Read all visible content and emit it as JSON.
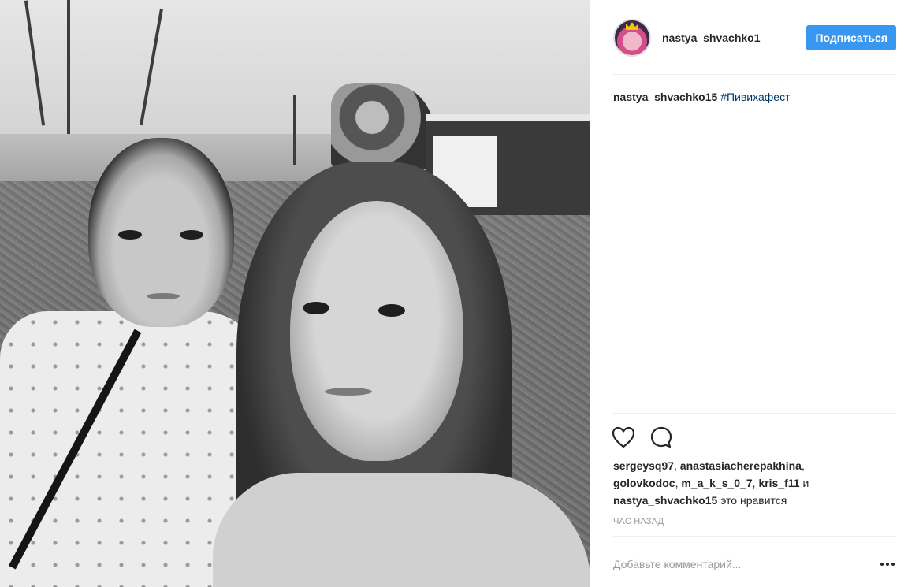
{
  "post": {
    "photo_alt": "",
    "author": {
      "username": "nastya_shvachko1",
      "avatar_icon": "avatar-icon"
    },
    "follow_label": "Подписаться",
    "caption": {
      "author": "nastya_shvachko15",
      "hashtag": "#Пивихафест"
    },
    "actions": {
      "like_icon": "heart-icon",
      "comment_icon": "comment-icon"
    },
    "likes": {
      "users": [
        "sergeysq97",
        "anastasiacherepakhina",
        "golovkodoc",
        "m_a_k_s_0_7",
        "kris_f11",
        "nastya_shvachko15"
      ],
      "sep": ",",
      "and": "и",
      "suffix": "это нравится"
    },
    "timestamp": "Час назад",
    "comment": {
      "placeholder": "Добавьте комментарий...",
      "more_icon": "more-icon"
    }
  },
  "colors": {
    "accent": "#3897f0",
    "hashtag": "#003569",
    "muted": "#999999",
    "divider": "#efefef"
  }
}
